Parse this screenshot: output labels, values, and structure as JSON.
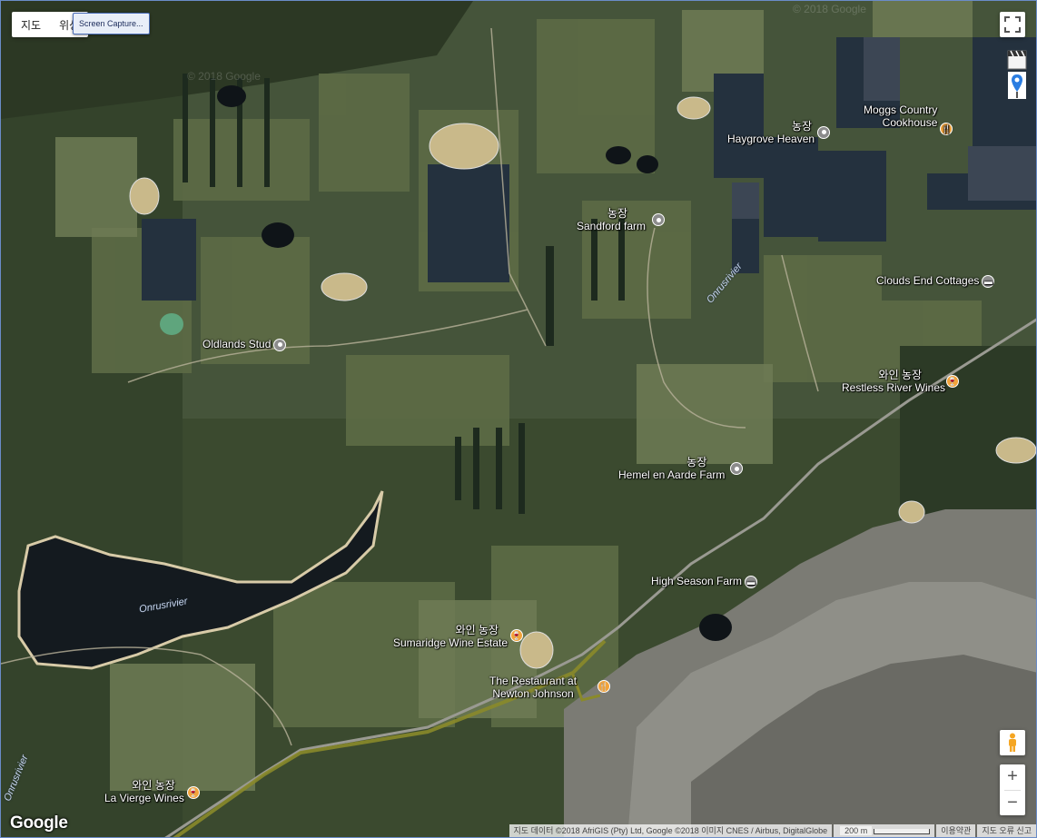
{
  "map_type": {
    "map": "지도",
    "satellite": "위성"
  },
  "capture_button": "Screen Capture...",
  "places": [
    {
      "id": "moggs",
      "name": "Moggs Country\nCookhouse",
      "category": "",
      "icon": "restaurant-icon"
    },
    {
      "id": "haygrove",
      "name": "Haygrove Heaven",
      "category": "농장",
      "icon": "farm-icon"
    },
    {
      "id": "sandford",
      "name": "Sandford farm",
      "category": "농장",
      "icon": "farm-icon"
    },
    {
      "id": "clouds",
      "name": "Clouds End Cottages",
      "category": "",
      "icon": "lodging-icon"
    },
    {
      "id": "oldlands",
      "name": "Oldlands Stud",
      "category": "",
      "icon": "farm-icon"
    },
    {
      "id": "restless",
      "name": "Restless River Wines",
      "category": "와인 농장",
      "icon": "winery-icon"
    },
    {
      "id": "hemel",
      "name": "Hemel en Aarde Farm",
      "category": "농장",
      "icon": "farm-icon"
    },
    {
      "id": "highseason",
      "name": "High Season Farm",
      "category": "",
      "icon": "lodging-icon"
    },
    {
      "id": "sumaridge",
      "name": "Sumaridge Wine Estate",
      "category": "와인 농장",
      "icon": "winery-icon"
    },
    {
      "id": "newton",
      "name": "The Restaurant at\nNewton Johnson",
      "category": "",
      "icon": "restaurant-icon"
    },
    {
      "id": "lavierge",
      "name": "La Vierge Wines",
      "category": "와인 농장",
      "icon": "winery-icon"
    }
  ],
  "rivers": [
    "Onrusrivier",
    "Onrusrivier",
    "Onrusrivier"
  ],
  "watermarks": [
    "© 2018 Google",
    "© 2018 Google"
  ],
  "logo": "Google",
  "footer": {
    "attribution": "지도 데이터 ©2018 AfriGIS (Pty) Ltd, Google ©2018 이미지 CNES / Airbus, DigitalGlobe",
    "scale": "200 m",
    "terms": "이용약관",
    "report": "지도 오류 신고"
  },
  "colors": {
    "pin_farm": "#8c8c8c",
    "pin_winery": "#f2a33a",
    "road": "#8a8a2a"
  }
}
